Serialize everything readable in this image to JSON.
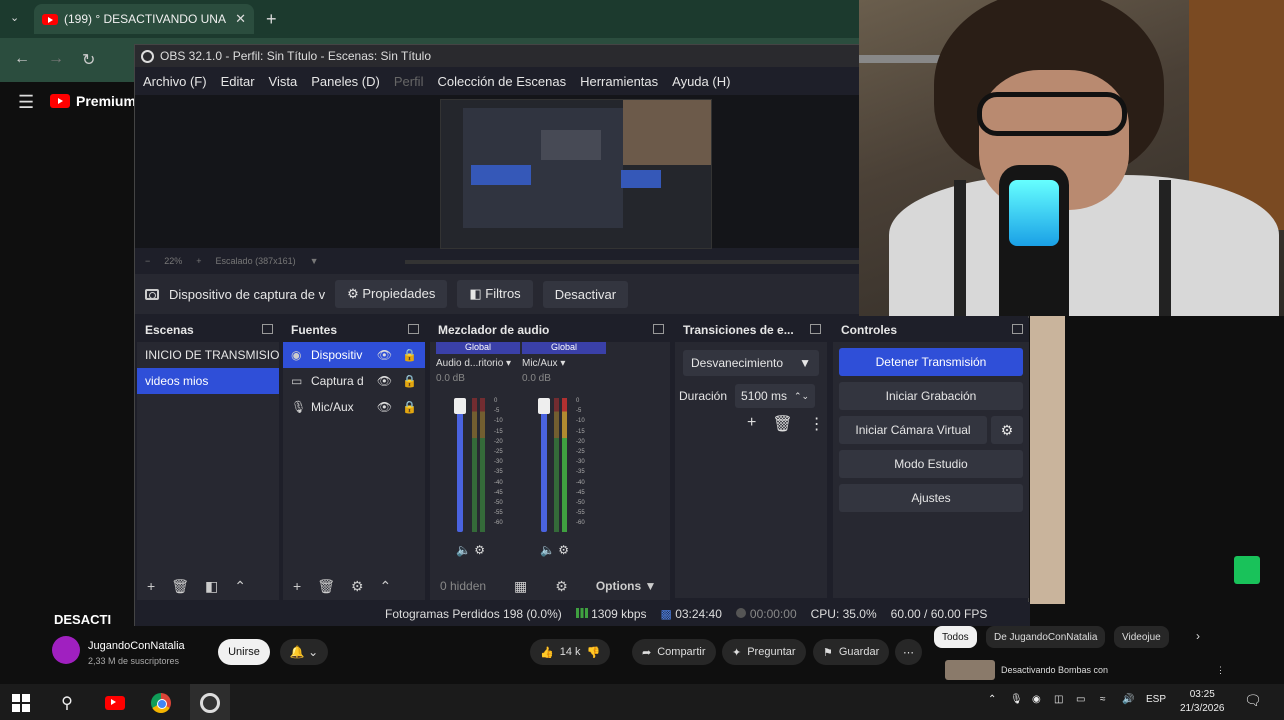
{
  "chrome": {
    "tab_title": "(199) ° DESACTIVANDO UNA",
    "close_glyph": "✕",
    "new_tab_glyph": "+",
    "tab_list_glyph": "⌄"
  },
  "youtube": {
    "logo_text": "Premium",
    "video_title": "DESACTI",
    "channel_name": "JugandoConNatalia",
    "channel_subs": "2,33 M de suscriptores",
    "join_label": "Unirse",
    "like_count": "14 k",
    "share_label": "Compartir",
    "ask_label": "Preguntar",
    "save_label": "Guardar",
    "more_glyph": "⋯",
    "chips": [
      "Todos",
      "De JugandoConNatalia",
      "Videojue"
    ],
    "rec_title": "Desactivando Bombas con"
  },
  "obs": {
    "title": "OBS 32.1.0 - Perfil: Sin Título - Escenas: Sin Título",
    "menu": [
      "Archivo (F)",
      "Editar",
      "Vista",
      "Paneles (D)",
      "Perfil",
      "Colección de Escenas",
      "Herramientas",
      "Ayuda (H)"
    ],
    "zoom": "22%",
    "zoom_mode": "Escalado (387x161)",
    "context": {
      "source_name": "Dispositivo de captura de v",
      "properties_label": "Propiedades",
      "filters_label": "Filtros",
      "deactivate_label": "Desactivar"
    },
    "scenes": {
      "title": "Escenas",
      "items": [
        "INICIO DE TRANSMISIO",
        "videos mios"
      ]
    },
    "sources": {
      "title": "Fuentes",
      "items": [
        "Dispositiv",
        "Captura d",
        "Mic/Aux"
      ]
    },
    "mixer": {
      "title": "Mezclador de audio",
      "channels": [
        {
          "badge": "Global",
          "name": "Audio d...ritorio",
          "db": "0.0 dB"
        },
        {
          "badge": "Global",
          "name": "Mic/Aux",
          "db": "0.0 dB"
        }
      ],
      "scale": [
        "0",
        "-5",
        "-10",
        "-15",
        "-20",
        "-25",
        "-30",
        "-35",
        "-40",
        "-45",
        "-50",
        "-55",
        "-60"
      ],
      "hidden_label": "0 hidden",
      "options_label": "Options"
    },
    "transitions": {
      "title": "Transiciones de e...",
      "selected": "Desvanecimiento",
      "duration_label": "Duración",
      "duration_value": "5100 ms"
    },
    "controls": {
      "title": "Controles",
      "stream_btn": "Detener Transmisión",
      "record_btn": "Iniciar Grabación",
      "vcam_btn": "Iniciar Cámara Virtual",
      "studio_btn": "Modo Estudio",
      "settings_btn": "Ajustes"
    },
    "status": {
      "dropped": "Fotogramas Perdidos 198 (0.0%)",
      "bitrate": "1309 kbps",
      "stream_time": "03:24:40",
      "rec_time": "00:00:00",
      "cpu": "CPU: 35.0%",
      "fps": "60.00 / 60.00 FPS"
    }
  },
  "taskbar": {
    "lang": "ESP",
    "time": "03:25",
    "date": "21/3/2026"
  },
  "colors": {
    "obs_accent": "#2f4fd8",
    "youtube_red": "#ff0000",
    "chrome_theme": "#2b4d3e"
  }
}
